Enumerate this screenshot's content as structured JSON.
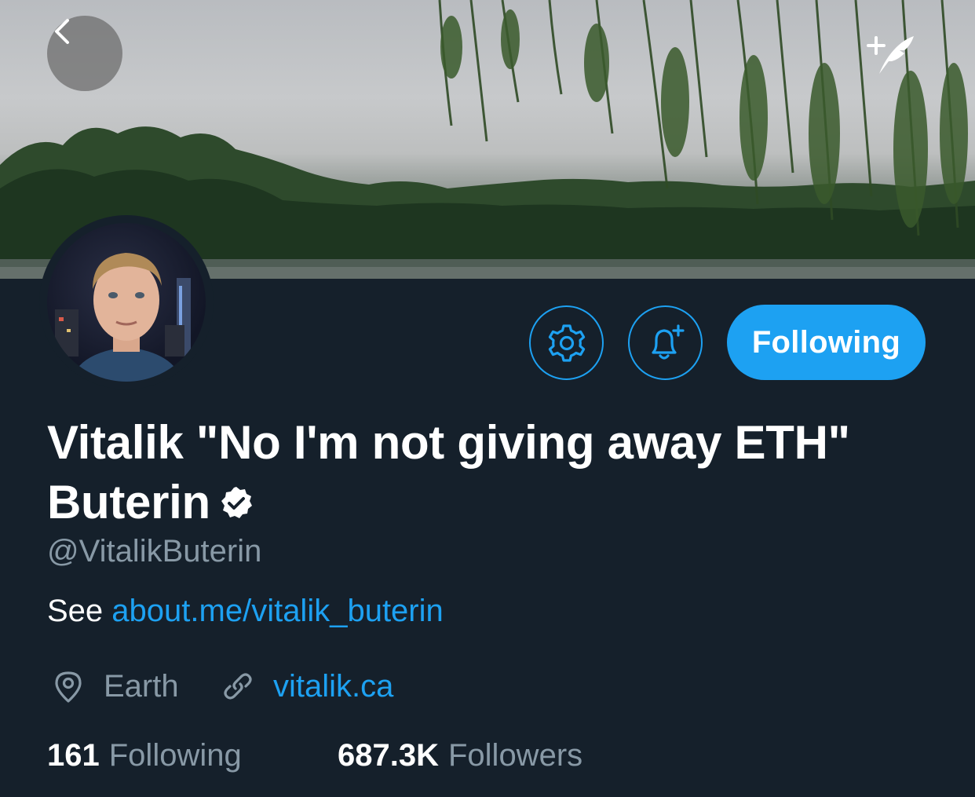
{
  "header": {
    "back_icon": "chevron-left-icon",
    "compose_icon": "compose-quill-icon"
  },
  "profile": {
    "display_name": "Vitalik \"No I'm not giving away ETH\" Buterin",
    "verified": true,
    "handle": "@VitalikButerin",
    "bio_prefix": "See",
    "bio_link": "about.me/vitalik_buterin",
    "location": "Earth",
    "website": "vitalik.ca"
  },
  "actions": {
    "settings_icon": "gear-icon",
    "notify_icon": "bell-plus-icon",
    "follow_label": "Following"
  },
  "stats": {
    "following_count": "161",
    "following_label": "Following",
    "followers_count": "687.3K",
    "followers_label": "Followers"
  },
  "colors": {
    "background": "#15202b",
    "accent": "#1da1f2",
    "secondary_text": "#8899a6",
    "primary_text": "#ffffff"
  }
}
